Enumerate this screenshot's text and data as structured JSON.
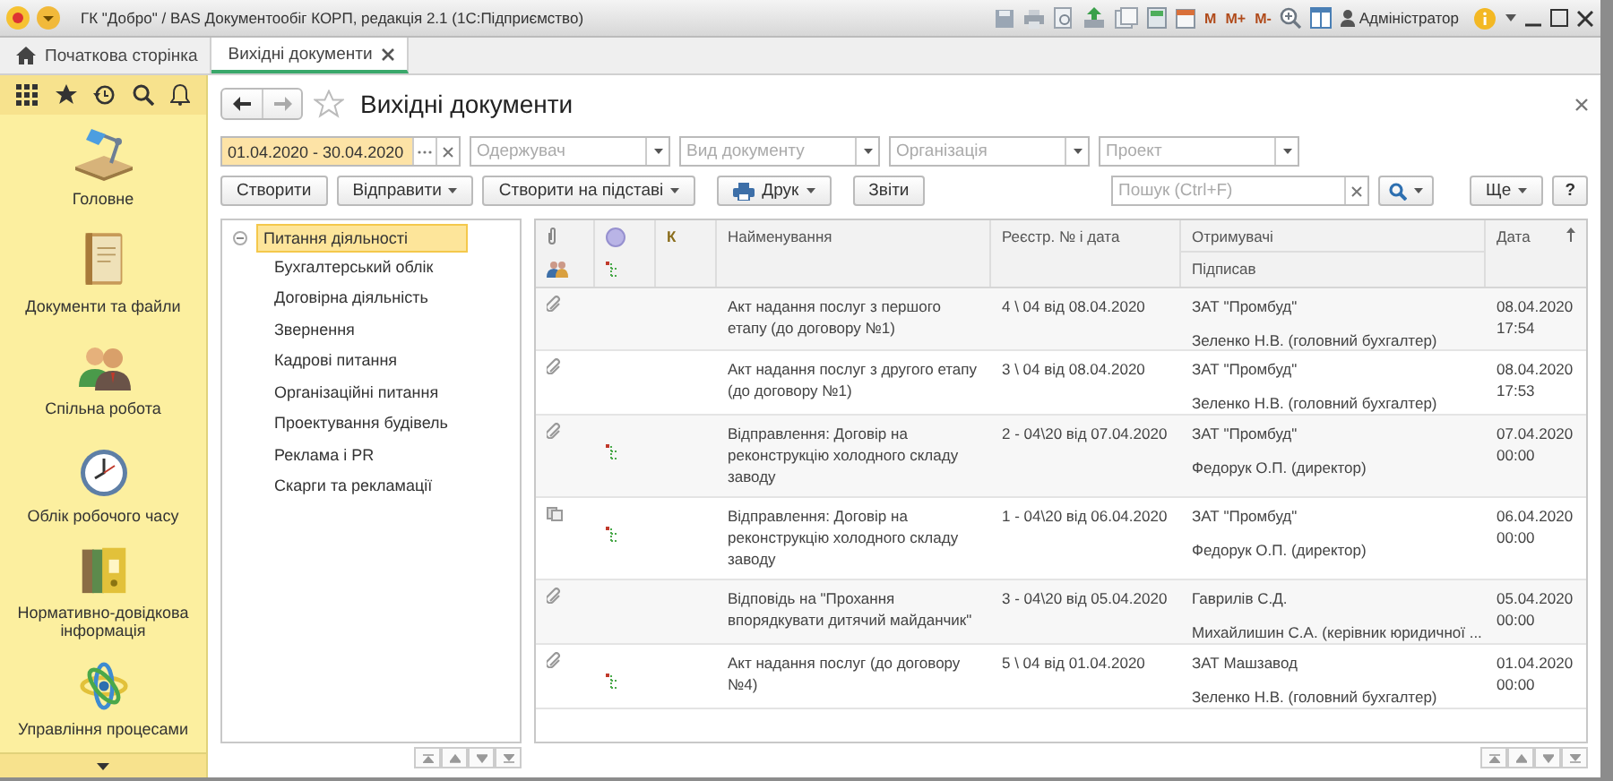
{
  "title_bar": {
    "app_title": "ГК \"Добро\" / BAS Документообіг КОРП, редакція 2.1  (1С:Підприємство)",
    "memory_buttons": [
      "M",
      "M+",
      "M-"
    ],
    "user": "Адміністратор"
  },
  "tabs": [
    {
      "label": "Початкова сторінка",
      "selected": false,
      "kind": "home"
    },
    {
      "label": "Вихідні документи",
      "selected": true,
      "kind": "closable"
    }
  ],
  "sidebar": {
    "sections": [
      {
        "label": "Головне",
        "kind": "lamp"
      },
      {
        "label": "Документи та файли",
        "kind": "book"
      },
      {
        "label": "Спільна робота",
        "kind": "people"
      },
      {
        "label": "Облік робочого часу",
        "kind": "clock"
      },
      {
        "label": "Нормативно-довідкова інформація",
        "kind": "binders"
      },
      {
        "label": "Управління процесами",
        "kind": "orbit"
      }
    ]
  },
  "form": {
    "title": "Вихідні документи",
    "filters": [
      {
        "kind": "period",
        "value": "01.04.2020 - 30.04.2020"
      },
      {
        "kind": "select",
        "placeholder": "Одержувач"
      },
      {
        "kind": "select",
        "placeholder": "Вид документу"
      },
      {
        "kind": "select",
        "placeholder": "Організація"
      },
      {
        "kind": "select",
        "placeholder": "Проект"
      }
    ],
    "toolbar": [
      {
        "kind": "plain",
        "label": "Створити"
      },
      {
        "kind": "menu",
        "label": "Відправити"
      },
      {
        "kind": "menu",
        "label": "Створити на підставі"
      },
      {
        "kind": "print",
        "label": "Друк"
      },
      {
        "kind": "plain",
        "label": "Звіти"
      }
    ],
    "search": {
      "placeholder": "Пошук (Ctrl+F)"
    },
    "more_button": "Ще",
    "help_button": "?"
  },
  "tree": {
    "label": "Питання діяльності",
    "selected": true,
    "expanded": true,
    "children": [
      {
        "label": "Бухгалтерський облік",
        "selected": false
      },
      {
        "label": "Договірна діяльність",
        "selected": false
      },
      {
        "label": "Звернення",
        "selected": false
      },
      {
        "label": "Кадрові питання",
        "selected": false
      },
      {
        "label": "Організаційні питання",
        "selected": false
      },
      {
        "label": "Проектування будівель",
        "selected": false
      },
      {
        "label": "Реклама і PR",
        "selected": false
      },
      {
        "label": "Скарги та рекламації",
        "selected": false
      }
    ]
  },
  "table": {
    "headers": {
      "k": "К",
      "name": "Найменування",
      "reg": "Реєстр. № і дата",
      "recipients": "Отримувачі",
      "signed": "Підписав",
      "date": "Дата"
    },
    "rows": [
      {
        "kind": "clip",
        "route": false,
        "name": "Акт надання послуг з першого етапу (до договору №1)",
        "reg": "4 \\ 04 від 08.04.2020",
        "recipient": "ЗАТ \"Промбуд\"",
        "signer": "Зеленко Н.В. (головний бухгалтер)",
        "date": "08.04.2020",
        "time": "17:54"
      },
      {
        "kind": "clip",
        "route": false,
        "name": "Акт надання послуг з другого етапу (до договору №1)",
        "reg": "3 \\ 04 від 08.04.2020",
        "recipient": "ЗАТ \"Промбуд\"",
        "signer": "Зеленко Н.В. (головний бухгалтер)",
        "date": "08.04.2020",
        "time": "17:53"
      },
      {
        "kind": "clip",
        "route": true,
        "name": "Відправлення: Договір на реконструкцію холодного складу заводу",
        "reg": "2 - 04\\20 від 07.04.2020",
        "recipient": "ЗАТ \"Промбуд\"",
        "signer": "Федорук О.П. (директор)",
        "date": "07.04.2020",
        "time": "00:00"
      },
      {
        "kind": "stack",
        "route": true,
        "name": "Відправлення: Договір на реконструкцію холодного складу заводу",
        "reg": "1 - 04\\20 від 06.04.2020",
        "recipient": "ЗАТ \"Промбуд\"",
        "signer": "Федорук О.П. (директор)",
        "date": "06.04.2020",
        "time": "00:00"
      },
      {
        "kind": "clip",
        "route": false,
        "name": "Відповідь на \"Прохання впорядкувати дитячий майданчик\"",
        "reg": "3 - 04\\20 від 05.04.2020",
        "recipient": "Гаврилів С.Д.",
        "signer": "Михайлишин С.А. (керівник юридичної ...",
        "date": "05.04.2020",
        "time": "00:00"
      },
      {
        "kind": "clip",
        "route": true,
        "name": "Акт надання послуг (до договору №4)",
        "reg": "5 \\ 04 від 01.04.2020",
        "recipient": "ЗАТ Машзавод",
        "signer": "Зеленко Н.В. (головний бухгалтер)",
        "date": "01.04.2020",
        "time": "00:00"
      }
    ]
  }
}
